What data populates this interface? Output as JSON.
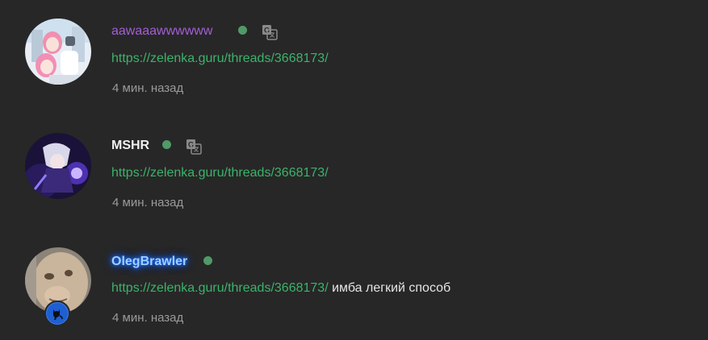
{
  "comments": [
    {
      "username": "aawaaawwwwww",
      "link": "https://zelenka.guru/threads/3668173/",
      "text": "",
      "time": "4 мин. назад",
      "online": true,
      "translate": true
    },
    {
      "username": "MSHR",
      "link": "https://zelenka.guru/threads/3668173/",
      "text": "",
      "time": "4 мин. назад",
      "online": true,
      "translate": true
    },
    {
      "username": "OlegBrawler",
      "link": "https://zelenka.guru/threads/3668173/",
      "text": "имба легкий способ",
      "time": "4 мин. назад",
      "online": true,
      "translate": false
    }
  ],
  "colors": {
    "background": "#272727",
    "link": "#3cb36b",
    "online": "#4f9a67",
    "username_purple": "#a45ed6",
    "username_glow": "#1e6cff"
  }
}
